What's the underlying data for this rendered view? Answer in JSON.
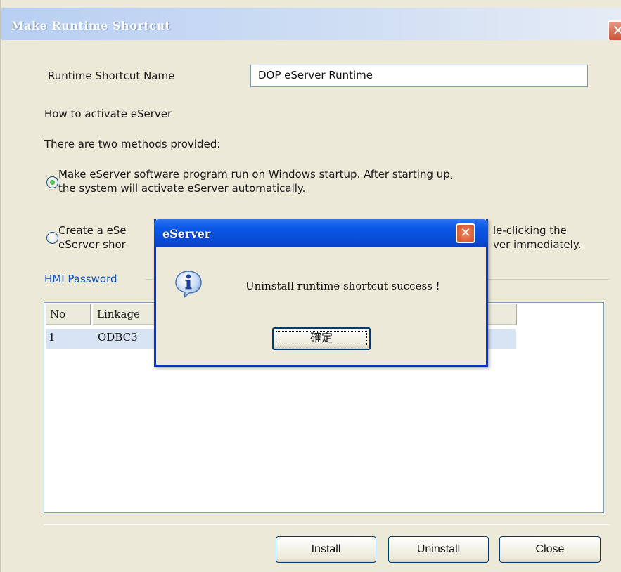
{
  "window": {
    "title": "Make Runtime Shortcut",
    "close_glyph": "✕",
    "shortcut_name_label": "Runtime Shortcut Name",
    "shortcut_name_value": "DOP eServer Runtime",
    "activate_heading": "How to activate eServer",
    "methods_text": "There are two methods provided:",
    "option1_line1": "Make eServer software program run on Windows startup. After starting up,",
    "option1_line2": "the system will activate eServer automatically.",
    "option2_left_line1": "Create a eSe",
    "option2_left_line2": "eServer shor",
    "option2_right_line1": "le-clicking the",
    "option2_right_line2": "ver immediately.",
    "group_label": "HMI Password",
    "table": {
      "col_no": "No",
      "col_linkage": "Linkage",
      "row1_no": "1",
      "row1_linkage": "ODBC3"
    },
    "buttons": {
      "install": "Install",
      "uninstall": "Uninstall",
      "close": "Close"
    }
  },
  "dialog": {
    "title": "eServer",
    "close_glyph": "✕",
    "icon": "info-icon",
    "message": "Uninstall runtime shortcut success !",
    "ok_label": "確定"
  },
  "colors": {
    "window_bg": "#ece9d8",
    "dialog_titlebar": "#0a58e8",
    "radio_selected": "#1f9a2a",
    "group_label": "#0b4eb8"
  }
}
